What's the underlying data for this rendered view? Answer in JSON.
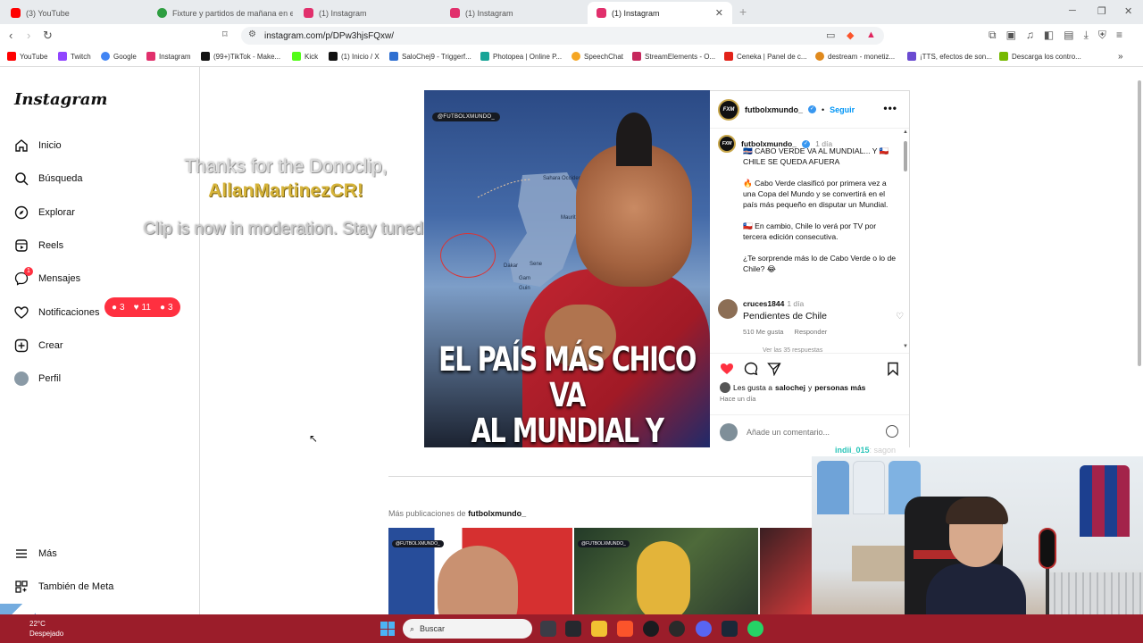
{
  "browser": {
    "tabs": [
      {
        "title": "(3) YouTube",
        "color": "#ff0000"
      },
      {
        "title": "Fixture y partidos de mañana en el F...",
        "color": "#2e9e41"
      },
      {
        "title": "(1) Instagram",
        "color": "#e1306c"
      },
      {
        "title": "(1) Instagram",
        "color": "#e1306c"
      },
      {
        "title": "(1) Instagram",
        "color": "#e1306c"
      }
    ],
    "url": "instagram.com/p/DPw3hjsFQxw/",
    "bookmarks": [
      {
        "label": "YouTube",
        "color": "#ff0000"
      },
      {
        "label": "Twitch",
        "color": "#9146ff"
      },
      {
        "label": "Google",
        "color": "#4285f4"
      },
      {
        "label": "Instagram",
        "color": "#e1306c"
      },
      {
        "label": "(99+)TikTok - Make...",
        "color": "#111111"
      },
      {
        "label": "Kick",
        "color": "#53fc18"
      },
      {
        "label": "(1) Inicio / X",
        "color": "#111111"
      },
      {
        "label": "SaloChej9 - Triggerf...",
        "color": "#2f6fd1"
      },
      {
        "label": "Photopea | Online P...",
        "color": "#18a497"
      },
      {
        "label": "SpeechChat",
        "color": "#f5a623"
      },
      {
        "label": "StreamElements - O...",
        "color": "#c6285d"
      },
      {
        "label": "Ceneka | Panel de c...",
        "color": "#e2231a"
      },
      {
        "label": "destream - monetiz...",
        "color": "#e08a1e"
      },
      {
        "label": "¡TTS, efectos de son...",
        "color": "#6a4bd1"
      },
      {
        "label": "Descarga los contro...",
        "color": "#76b900"
      }
    ]
  },
  "sidebar": {
    "logo": "Instagram",
    "items": [
      {
        "label": "Inicio",
        "icon": "home-icon"
      },
      {
        "label": "Búsqueda",
        "icon": "search-icon"
      },
      {
        "label": "Explorar",
        "icon": "explore-icon"
      },
      {
        "label": "Reels",
        "icon": "reels-icon"
      },
      {
        "label": "Mensajes",
        "icon": "messenger-icon",
        "badge": "1"
      },
      {
        "label": "Notificaciones",
        "icon": "heart-icon"
      },
      {
        "label": "Crear",
        "icon": "plus-icon"
      },
      {
        "label": "Perfil",
        "icon": "avatar"
      }
    ],
    "notif_pill": {
      "comments": "3",
      "likes": "11",
      "follows": "3"
    },
    "bottom": [
      {
        "label": "Más",
        "icon": "menu-icon"
      },
      {
        "label": "También de Meta",
        "icon": "meta-icon"
      }
    ]
  },
  "donoclip": {
    "line1": "Thanks for the Donoclip,",
    "name": "AllanMartinezCR!",
    "line2": "Clip is now in moderation. Stay tuned!"
  },
  "post": {
    "image_tag": "@FUTBOLXMUNDO_",
    "headline_l1": "EL PAÍS MÁS CHICO VA",
    "headline_l2": "AL MUNDIAL Y CHILE NO",
    "map_labels": [
      "Sahara Occidental",
      "Maurit",
      "Dakar",
      "Sene",
      "Gam",
      "Guin"
    ],
    "author": "futbolxmundo_",
    "author_logo": "FXM",
    "follow": "Seguir",
    "caption_time": "1 día",
    "caption": [
      "🇨🇻 CABO VERDE VA AL MUNDIAL... Y 🇨🇱 CHILE SE QUEDA AFUERA",
      "🔥 Cabo Verde clasificó por primera vez a una Copa del Mundo y se convertirá en el país más pequeño en disputar un Mundial.",
      "🇨🇱 En cambio, Chile lo verá por TV por tercera edición consecutiva.",
      "¿Te sorprende más lo de Cabo Verde o lo de Chile? 😂"
    ],
    "comment": {
      "user": "cruces1844",
      "time": "1 día",
      "text": "Pendientes de Chile",
      "likes": "510 Me gusta",
      "reply": "Responder",
      "more_replies": "Ver las 35 respuestas"
    },
    "liked_by_prefix": "Les gusta a",
    "liked_by_user": "salochej",
    "liked_by_and": "y",
    "liked_by_others": "personas más",
    "posted_ago": "Hace un día",
    "add_comment_placeholder": "Añade un comentario..."
  },
  "more_posts": {
    "prefix": "Más publicaciones de",
    "user": "futbolxmundo_"
  },
  "stream": {
    "chat_user": "indii_015",
    "chat_text": ": sagon"
  },
  "taskbar": {
    "temp": "22°C",
    "weather": "Despejado",
    "search": "Buscar"
  }
}
